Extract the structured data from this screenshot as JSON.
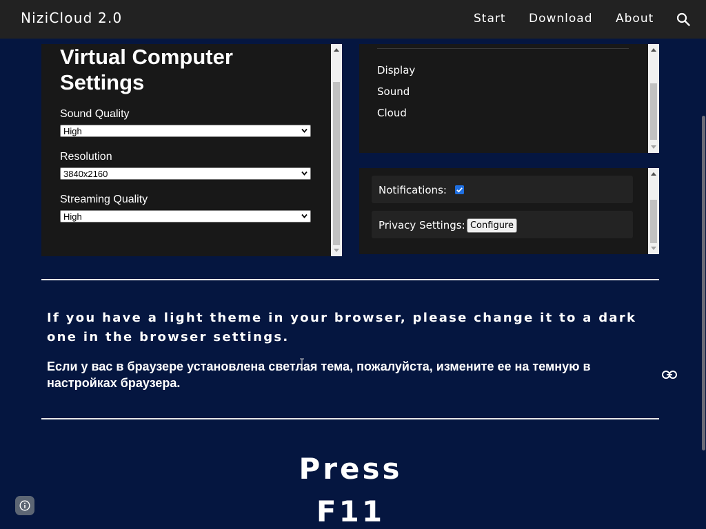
{
  "header": {
    "brand": "NiziCloud 2.0",
    "nav": [
      "Start",
      "Download",
      "About"
    ]
  },
  "settings_panel": {
    "title": "Virtual Computer Settings",
    "fields": [
      {
        "label": "Sound Quality",
        "value": "High"
      },
      {
        "label": "Resolution",
        "value": "3840x2160"
      },
      {
        "label": "Streaming Quality",
        "value": "High"
      }
    ]
  },
  "categories": {
    "items": [
      "Display",
      "Sound",
      "Cloud"
    ]
  },
  "options": {
    "notifications_label": "Notifications:",
    "notifications_checked": true,
    "privacy_label": "Privacy Settings:",
    "configure_label": "Configure"
  },
  "notice": {
    "english": "If you have a light theme in your browser, please change it to a dark one in the browser settings.",
    "russian": "Если у вас в браузере установлена светлая тема, пожалуйста, измените ее на темную в настройках браузера."
  },
  "press": {
    "line1": "Press",
    "line2": "F11"
  },
  "colors": {
    "page_background": "#051640",
    "topbar": "#222222",
    "panel": "#181818",
    "checkbox": "#1f6fe0"
  }
}
